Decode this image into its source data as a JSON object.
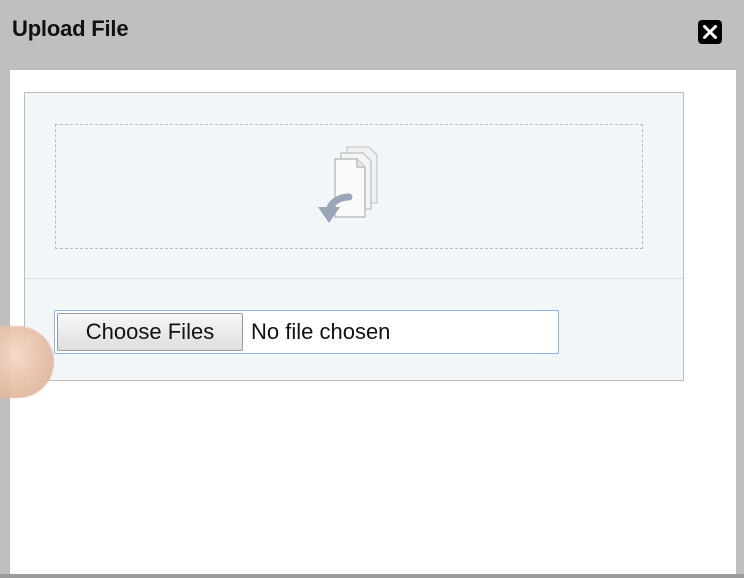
{
  "dialog": {
    "title": "Upload File",
    "close_icon": "close-x-icon"
  },
  "upload": {
    "drop_icon": "drop-files-icon",
    "choose_button_label": "Choose Files",
    "file_status": "No file chosen"
  },
  "colors": {
    "titlebar": "#bfbfbf",
    "panel_bg": "#f3f6f9",
    "input_focus_border": "#8fb3e6"
  }
}
